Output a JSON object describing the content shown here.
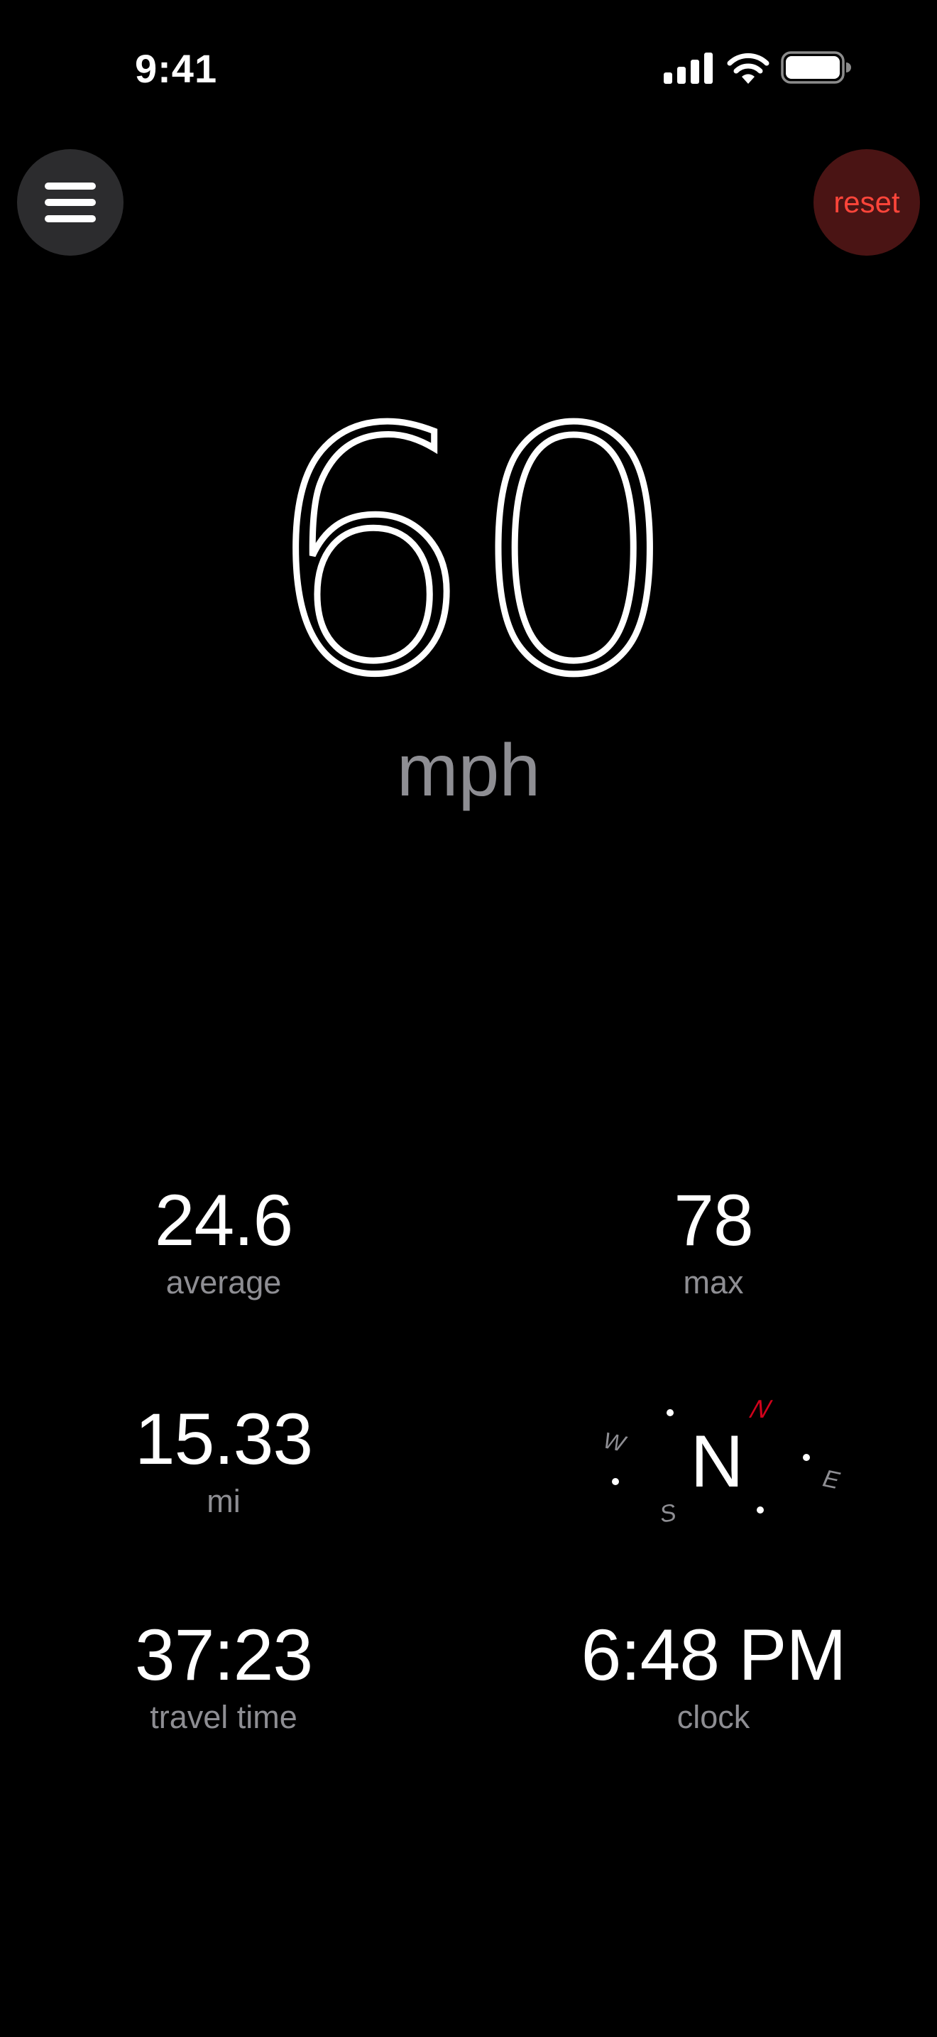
{
  "status_bar": {
    "time": "9:41",
    "icons": [
      "cellular-signal-icon",
      "wifi-icon",
      "battery-icon"
    ]
  },
  "toolbar": {
    "menu_icon": "hamburger-menu-icon",
    "reset_label": "reset"
  },
  "speed": {
    "value": "60",
    "unit": "mph"
  },
  "stats": {
    "average": {
      "value": "24.6",
      "label": "average"
    },
    "max": {
      "value": "78",
      "label": "max"
    },
    "distance": {
      "value": "15.33",
      "label": "mi"
    },
    "travel_time": {
      "value": "37:23",
      "label": "travel time"
    },
    "clock": {
      "value": "6:48 PM",
      "label": "clock"
    }
  },
  "compass": {
    "heading": "N",
    "marks": [
      "N",
      "E",
      "S",
      "W"
    ],
    "north_color": "#d0021b"
  },
  "colors": {
    "background": "#000000",
    "accent_red": "#ff453a",
    "secondary_text": "#8e8e93"
  }
}
